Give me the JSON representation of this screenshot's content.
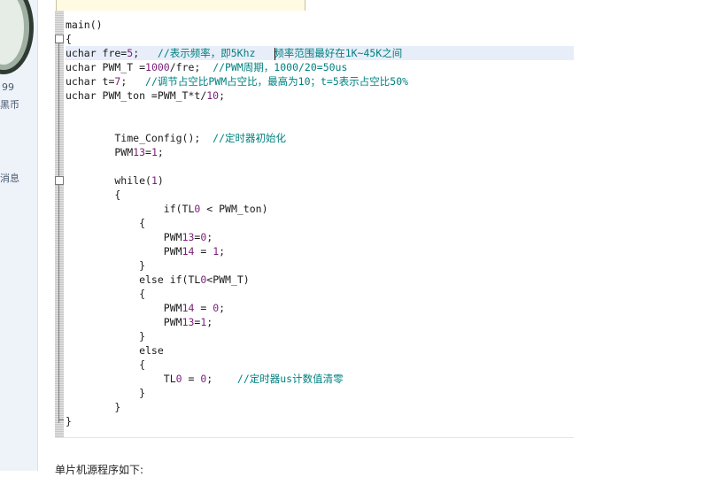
{
  "sidebar": {
    "count": "99",
    "coin_label": "黑币",
    "messages_label": "消息"
  },
  "code": {
    "lines": [
      {
        "t": "main()"
      },
      {
        "t": "{"
      },
      {
        "t": "uchar fre=5;   //表示频率，即5Khz   频率范围最好在1K~45K之间"
      },
      {
        "t": "uchar PWM_T =1000/fre;  //PWM周期，1000/20=50us"
      },
      {
        "t": "uchar t=7;   //调节占空比PWM占空比，最高为10；t=5表示占空比50%"
      },
      {
        "t": "uchar PWM_ton =PWM_T*t/10;"
      },
      {
        "t": ""
      },
      {
        "t": ""
      },
      {
        "t": "        Time_Config();  //定时器初始化"
      },
      {
        "t": "        PWM13=1;"
      },
      {
        "t": ""
      },
      {
        "t": "        while(1)"
      },
      {
        "t": "        {"
      },
      {
        "t": "                if(TL0 < PWM_ton)"
      },
      {
        "t": "            {"
      },
      {
        "t": "                PWM13=0;"
      },
      {
        "t": "                PWM14 = 1;"
      },
      {
        "t": "            }"
      },
      {
        "t": "            else if(TL0<PWM_T)"
      },
      {
        "t": "            {"
      },
      {
        "t": "                PWM14 = 0;"
      },
      {
        "t": "                PWM13=1;"
      },
      {
        "t": "            }"
      },
      {
        "t": "            else"
      },
      {
        "t": "            {"
      },
      {
        "t": "                TL0 = 0;    //定时器us计数值清零"
      },
      {
        "t": "            }"
      },
      {
        "t": "        }"
      },
      {
        "t": "}"
      }
    ]
  },
  "bottom_text": "单片机源程序如下:",
  "colors": {
    "comment": "#008080",
    "number": "#7a1d7a",
    "highlight": "#e8eef9"
  }
}
